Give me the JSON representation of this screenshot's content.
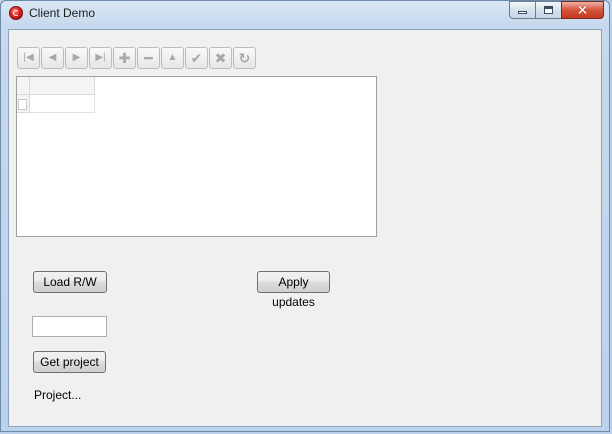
{
  "window": {
    "title": "Client Demo",
    "close_glyph": "✕"
  },
  "navigator": {
    "buttons": [
      {
        "name": "first-record",
        "glyph": "|◀"
      },
      {
        "name": "prior-record",
        "glyph": "◀"
      },
      {
        "name": "next-record",
        "glyph": "▶"
      },
      {
        "name": "last-record",
        "glyph": "▶|"
      },
      {
        "name": "insert-record",
        "glyph": "✚"
      },
      {
        "name": "delete-record",
        "glyph": "━"
      },
      {
        "name": "edit-record",
        "glyph": "▲"
      },
      {
        "name": "post-edit",
        "glyph": "✔"
      },
      {
        "name": "cancel-edit",
        "glyph": "✖"
      },
      {
        "name": "refresh-data",
        "glyph": "↻"
      }
    ]
  },
  "buttons": {
    "load_rw": "Load R/W",
    "apply_updates": "Apply updates",
    "get_project": "Get project"
  },
  "project_input": {
    "value": ""
  },
  "labels": {
    "project": "Project..."
  },
  "colors": {
    "titlebar": "#c6d9ee",
    "client_bg": "#f0f0f0",
    "close_button": "#c2391f"
  }
}
